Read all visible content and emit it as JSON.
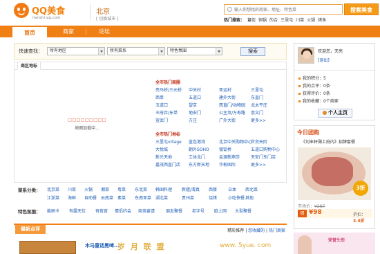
{
  "header": {
    "logo_text": "QQ美食",
    "logo_sub": "meishi.qq.com",
    "city": "北京",
    "switch_city": "[ 切换城市 ]",
    "search_placeholder": "输入你想找的商家、地址、特色菜",
    "search_button": "搜索美食",
    "hot_label": "热门搜索：",
    "hot_terms": [
      "簋街",
      "铜锅",
      "的合",
      "三里屯",
      "川菜",
      "火锅",
      "烤鱼"
    ]
  },
  "nav": {
    "tabs": [
      "首页",
      "商家",
      "论坛"
    ]
  },
  "quick": {
    "label": "快速查找：",
    "area_value": "所有地区",
    "cuisine_value": "所有菜系",
    "atmosphere_value": "特色氛围",
    "search_button": "搜索"
  },
  "area_panel": {
    "tab": "商区地标",
    "map_dots": "□□□□□□□□□",
    "loading": "地图加载中...",
    "hot_business_title": "全市热门商圈",
    "hot_business": [
      [
        "亮马桥/三元桥",
        "中关村",
        "亚运村",
        "三里屯"
      ],
      [
        "西单",
        "五道口",
        "建外大街",
        "东直门"
      ],
      [
        "五道口",
        "望京",
        "西直门/动物园",
        "北太平庄"
      ],
      [
        "王府井/东单",
        "地安门",
        "公主坟/万寿路",
        "崇文门"
      ],
      [
        "宣武门",
        "方庄",
        "广外大街",
        "更多>>"
      ]
    ],
    "hot_landmark_title": "全市热门地标",
    "hot_landmark": [
      [
        "三里屯village",
        "蓝色港湾",
        "北京中关购物中心",
        "世贸天阶"
      ],
      [
        "大悦城",
        "朝外SOHO",
        "银锭桥",
        "五道口购物中心"
      ],
      [
        "新光天地",
        "工体北门",
        "金源新燕莎",
        "天安门东门店"
      ],
      [
        "嘉茂西直门店",
        "东方新天地",
        "华彬国际",
        "更多>>"
      ]
    ]
  },
  "cuisine": {
    "label": "菜系分类：",
    "rows": [
      [
        "北京菜",
        "川菜",
        "火锅",
        "湘菜",
        "粤菜",
        "东北菜",
        "韩国料理",
        "新疆/清真",
        "西餐",
        "日本",
        "西北菜"
      ],
      [
        "江浙菜",
        "海鲜",
        "自助餐",
        "云南菜",
        "素菜",
        "东南亚菜",
        "湖北菜",
        "贵州菜",
        "烧烤",
        "小吃快餐",
        "其他"
      ]
    ]
  },
  "feature": {
    "label": "特色氛围：",
    "items": [
      "能刷卡",
      "有露天位",
      "有夜宵",
      "情侣约会",
      "商务宴请",
      "朋友聚餐",
      "老字号",
      "欧上网",
      "大型聚餐"
    ]
  },
  "reviews": {
    "tab": "最新点评",
    "links": [
      "精彩推荐",
      "您收藏的",
      "热门商家"
    ],
    "first_title": "木马童话黑啤..."
  },
  "user_box": {
    "welcome": "欢迎您，天亮",
    "exit": "[退出]",
    "stats": [
      "我的积分：5",
      "我的点评：0条",
      "获得评价：0条",
      "我的收藏：0个商家"
    ],
    "my_page": "个人主页"
  },
  "tuan": {
    "title": "今日团购",
    "desc": "《刘丰轩涮上府内》招牌套餐",
    "badge": "3折",
    "market_label": "市场价：",
    "market_price": "¥287",
    "price_tag": "团",
    "price": "¥98",
    "discount_label": "折扣：",
    "discount": "3.4折"
  },
  "ad": {
    "text": "荣誉头衔"
  },
  "watermark": {
    "cn": "岁 月 联 盟",
    "url": "www. 5yue. com"
  }
}
